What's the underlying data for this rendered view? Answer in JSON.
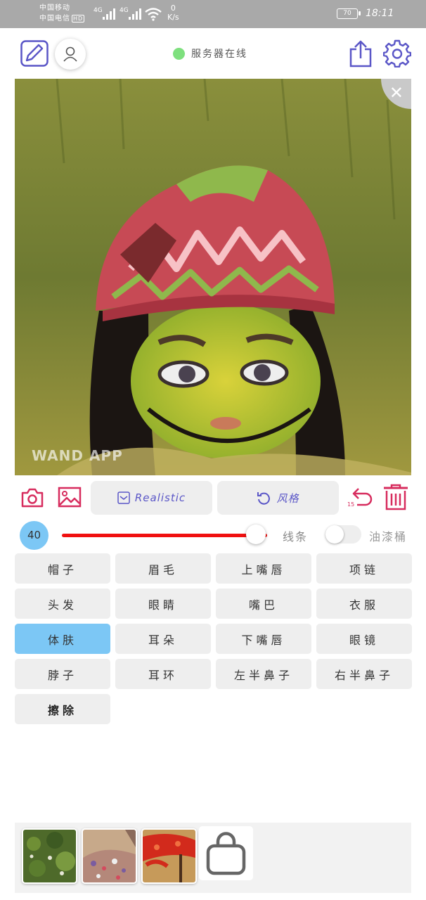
{
  "status_bar": {
    "carrier1": "中国移动",
    "carrier2": "中国电信",
    "hd": "HD",
    "net1": "4G",
    "net2": "4G",
    "speed_value": "0",
    "speed_unit": "K/s",
    "battery": "70",
    "time": "18:11"
  },
  "header": {
    "server_status": "服务器在线",
    "server_status_color": "#7ee07e",
    "icons": [
      "edit-icon",
      "user-icon",
      "share-icon",
      "settings-icon"
    ]
  },
  "canvas": {
    "watermark": "WAND APP",
    "close_label": "✕"
  },
  "toolbar": {
    "style_mode": "Realistic",
    "style_button": "风格",
    "undo_count": "15",
    "accent": "#d72c5e",
    "label_color": "#5a56c7"
  },
  "brush": {
    "size": "40",
    "slider_fraction": 0.82,
    "line_label": "线条",
    "bucket_label": "油漆桶",
    "bucket_enabled": false
  },
  "parts": [
    {
      "label": "帽子",
      "active": false
    },
    {
      "label": "眉毛",
      "active": false
    },
    {
      "label": "上嘴唇",
      "active": false
    },
    {
      "label": "项链",
      "active": false
    },
    {
      "label": "头发",
      "active": false
    },
    {
      "label": "眼睛",
      "active": false
    },
    {
      "label": "嘴巴",
      "active": false
    },
    {
      "label": "衣服",
      "active": false
    },
    {
      "label": "体肤",
      "active": true
    },
    {
      "label": "耳朵",
      "active": false
    },
    {
      "label": "下嘴唇",
      "active": false
    },
    {
      "label": "眼镜",
      "active": false
    },
    {
      "label": "脖子",
      "active": false
    },
    {
      "label": "耳环",
      "active": false
    },
    {
      "label": "左半鼻子",
      "active": false
    },
    {
      "label": "右半鼻子",
      "active": false
    },
    {
      "label": "擦除",
      "active": false
    }
  ],
  "styles": {
    "thumbnails": [
      "style-thumb-green-foliage",
      "style-thumb-mosaic",
      "style-thumb-red-floral"
    ],
    "shop_icon": "shopping-bag-icon"
  }
}
